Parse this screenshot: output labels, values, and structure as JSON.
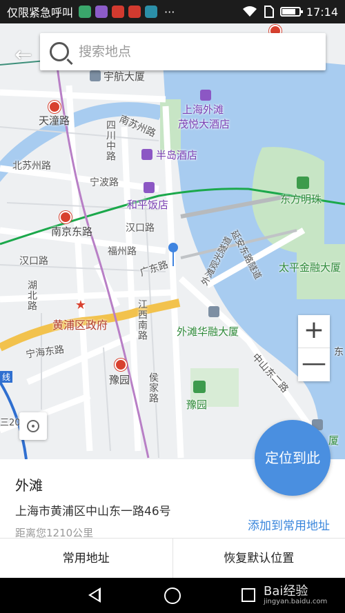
{
  "status_bar": {
    "carrier": "仅限紧急呼叫",
    "overflow": "···",
    "time": "17:14",
    "battery_level": 0.8
  },
  "search": {
    "placeholder": "搜索地点"
  },
  "map": {
    "labels": {
      "hanghang": "宇航大厦",
      "tiantong": "天潼路",
      "shanghai_bund": "上海外滩",
      "maoyue": "茂悦大酒店",
      "nansuzhou": "南苏州路",
      "sichuan": "四川中路",
      "peninsula": "半岛酒店",
      "beisuzhou": "北苏州路",
      "ningbo": "宁波路",
      "peace": "和平饭店",
      "pearl": "东方明珠",
      "nanjing_east": "南京东路",
      "hankou1": "汉口路",
      "tunnel": "延安东路隧道",
      "pedestrian": "外滩观光隧道",
      "fuzhou": "福州路",
      "hankou2": "汉口路",
      "guangdong": "广东路",
      "taiping": "太平金融大厦",
      "hubei": "湖北路",
      "huangpu_gov": "黄浦区政府",
      "jiangxi": "江西南路",
      "bund_finance": "外滩华融大厦",
      "ninghai": "宁海东路",
      "zhongshan": "中山东二路",
      "yuyuan_station": "豫园",
      "houjia": "侯家路",
      "yuyuan": "豫园",
      "line_badge": "线",
      "left_edge": "三20",
      "right_edge_1": "东",
      "right_edge_2": "厦"
    }
  },
  "zoom": {
    "in": "+",
    "out": "—"
  },
  "locate_button": "定位到此",
  "place": {
    "name": "外滩",
    "address": "上海市黄浦区中山东一路46号",
    "distance": "距离您1210公里",
    "add_favorite": "添加到常用地址"
  },
  "actions": {
    "favorites": "常用地址",
    "reset": "恢复默认位置"
  },
  "watermark": {
    "title": "Bai经验",
    "sub": "jingyan.baidu.com"
  },
  "colors": {
    "water": "#a8ccf0",
    "metro_green": "#1ba84b",
    "metro_purple": "#b87fc6",
    "highway": "#f2c24d",
    "accent_blue": "#4a8fe0"
  }
}
